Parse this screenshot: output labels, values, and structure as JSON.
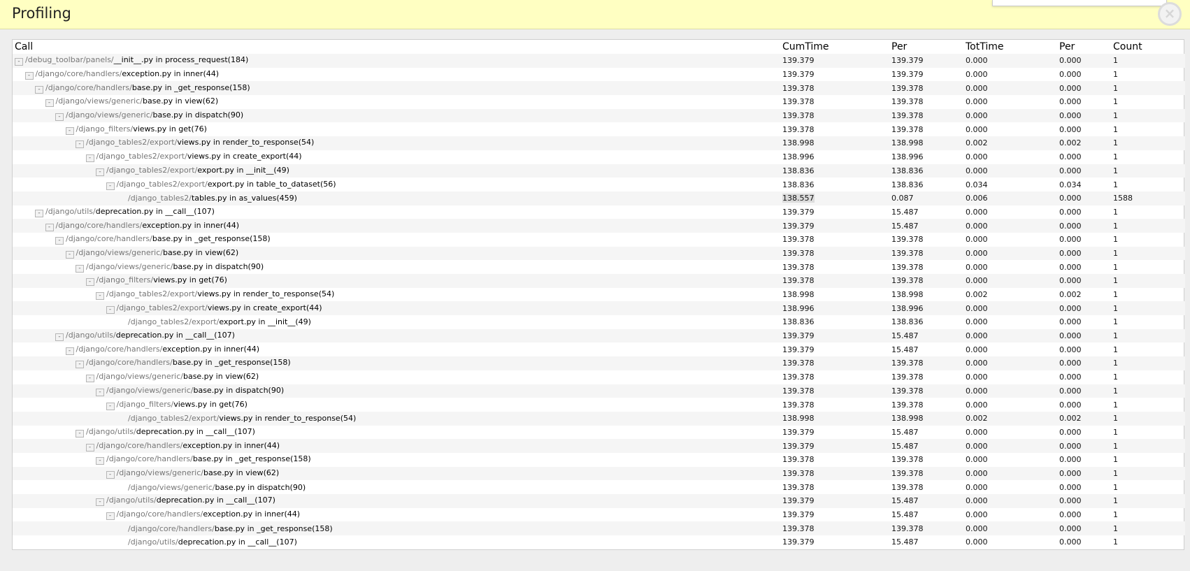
{
  "panel": {
    "title": "Profiling",
    "close_glyph": "×"
  },
  "table": {
    "headers": [
      "Call",
      "CumTime",
      "Per",
      "TotTime",
      "Per",
      "Count"
    ],
    "rows": [
      {
        "depth": 0,
        "toggle": true,
        "path": "/debug_toolbar/panels/",
        "file": "__init__.py",
        "mid": " in ",
        "func": "process_request",
        "line": "(184)",
        "cum": "139.379",
        "per": "139.379",
        "tot": "0.000",
        "per2": "0.000",
        "count": "1"
      },
      {
        "depth": 1,
        "toggle": true,
        "path": "/django/core/handlers/",
        "file": "exception.py",
        "mid": " in ",
        "func": "inner",
        "line": "(44)",
        "cum": "139.379",
        "per": "139.379",
        "tot": "0.000",
        "per2": "0.000",
        "count": "1"
      },
      {
        "depth": 2,
        "toggle": true,
        "path": "/django/core/handlers/",
        "file": "base.py",
        "mid": " in ",
        "func": "_get_response",
        "line": "(158)",
        "cum": "139.378",
        "per": "139.378",
        "tot": "0.000",
        "per2": "0.000",
        "count": "1"
      },
      {
        "depth": 3,
        "toggle": true,
        "path": "/django/views/generic/",
        "file": "base.py",
        "mid": " in ",
        "func": "view",
        "line": "(62)",
        "cum": "139.378",
        "per": "139.378",
        "tot": "0.000",
        "per2": "0.000",
        "count": "1"
      },
      {
        "depth": 4,
        "toggle": true,
        "path": "/django/views/generic/",
        "file": "base.py",
        "mid": " in ",
        "func": "dispatch",
        "line": "(90)",
        "cum": "139.378",
        "per": "139.378",
        "tot": "0.000",
        "per2": "0.000",
        "count": "1"
      },
      {
        "depth": 5,
        "toggle": true,
        "path": "/django_filters/",
        "file": "views.py",
        "mid": " in ",
        "func": "get",
        "line": "(76)",
        "cum": "139.378",
        "per": "139.378",
        "tot": "0.000",
        "per2": "0.000",
        "count": "1"
      },
      {
        "depth": 6,
        "toggle": true,
        "path": "/django_tables2/export/",
        "file": "views.py",
        "mid": " in ",
        "func": "render_to_response",
        "line": "(54)",
        "cum": "138.998",
        "per": "138.998",
        "tot": "0.002",
        "per2": "0.002",
        "count": "1"
      },
      {
        "depth": 7,
        "toggle": true,
        "path": "/django_tables2/export/",
        "file": "views.py",
        "mid": " in ",
        "func": "create_export",
        "line": "(44)",
        "cum": "138.996",
        "per": "138.996",
        "tot": "0.000",
        "per2": "0.000",
        "count": "1"
      },
      {
        "depth": 8,
        "toggle": true,
        "path": "/django_tables2/export/",
        "file": "export.py",
        "mid": " in ",
        "func": "__init__",
        "line": "(49)",
        "cum": "138.836",
        "per": "138.836",
        "tot": "0.000",
        "per2": "0.000",
        "count": "1"
      },
      {
        "depth": 9,
        "toggle": true,
        "path": "/django_tables2/export/",
        "file": "export.py",
        "mid": " in ",
        "func": "table_to_dataset",
        "line": "(56)",
        "cum": "138.836",
        "per": "138.836",
        "tot": "0.034",
        "per2": "0.034",
        "count": "1"
      },
      {
        "depth": 10,
        "toggle": false,
        "path": "/django_tables2/",
        "file": "tables.py",
        "mid": " in ",
        "func": "as_values",
        "line": "(459)",
        "cum": "138.557",
        "per": "0.087",
        "tot": "0.006",
        "per2": "0.000",
        "count": "1588",
        "highlight": true
      },
      {
        "depth": 2,
        "toggle": true,
        "path": "/django/utils/",
        "file": "deprecation.py",
        "mid": " in ",
        "func": "__call__",
        "line": "(107)",
        "cum": "139.379",
        "per": "15.487",
        "tot": "0.000",
        "per2": "0.000",
        "count": "1"
      },
      {
        "depth": 3,
        "toggle": true,
        "path": "/django/core/handlers/",
        "file": "exception.py",
        "mid": " in ",
        "func": "inner",
        "line": "(44)",
        "cum": "139.379",
        "per": "15.487",
        "tot": "0.000",
        "per2": "0.000",
        "count": "1"
      },
      {
        "depth": 4,
        "toggle": true,
        "path": "/django/core/handlers/",
        "file": "base.py",
        "mid": " in ",
        "func": "_get_response",
        "line": "(158)",
        "cum": "139.378",
        "per": "139.378",
        "tot": "0.000",
        "per2": "0.000",
        "count": "1"
      },
      {
        "depth": 5,
        "toggle": true,
        "path": "/django/views/generic/",
        "file": "base.py",
        "mid": " in ",
        "func": "view",
        "line": "(62)",
        "cum": "139.378",
        "per": "139.378",
        "tot": "0.000",
        "per2": "0.000",
        "count": "1"
      },
      {
        "depth": 6,
        "toggle": true,
        "path": "/django/views/generic/",
        "file": "base.py",
        "mid": " in ",
        "func": "dispatch",
        "line": "(90)",
        "cum": "139.378",
        "per": "139.378",
        "tot": "0.000",
        "per2": "0.000",
        "count": "1"
      },
      {
        "depth": 7,
        "toggle": true,
        "path": "/django_filters/",
        "file": "views.py",
        "mid": " in ",
        "func": "get",
        "line": "(76)",
        "cum": "139.378",
        "per": "139.378",
        "tot": "0.000",
        "per2": "0.000",
        "count": "1"
      },
      {
        "depth": 8,
        "toggle": true,
        "path": "/django_tables2/export/",
        "file": "views.py",
        "mid": " in ",
        "func": "render_to_response",
        "line": "(54)",
        "cum": "138.998",
        "per": "138.998",
        "tot": "0.002",
        "per2": "0.002",
        "count": "1"
      },
      {
        "depth": 9,
        "toggle": true,
        "path": "/django_tables2/export/",
        "file": "views.py",
        "mid": " in ",
        "func": "create_export",
        "line": "(44)",
        "cum": "138.996",
        "per": "138.996",
        "tot": "0.000",
        "per2": "0.000",
        "count": "1"
      },
      {
        "depth": 10,
        "toggle": false,
        "path": "/django_tables2/export/",
        "file": "export.py",
        "mid": " in ",
        "func": "__init__",
        "line": "(49)",
        "cum": "138.836",
        "per": "138.836",
        "tot": "0.000",
        "per2": "0.000",
        "count": "1"
      },
      {
        "depth": 4,
        "toggle": true,
        "path": "/django/utils/",
        "file": "deprecation.py",
        "mid": " in ",
        "func": "__call__",
        "line": "(107)",
        "cum": "139.379",
        "per": "15.487",
        "tot": "0.000",
        "per2": "0.000",
        "count": "1"
      },
      {
        "depth": 5,
        "toggle": true,
        "path": "/django/core/handlers/",
        "file": "exception.py",
        "mid": " in ",
        "func": "inner",
        "line": "(44)",
        "cum": "139.379",
        "per": "15.487",
        "tot": "0.000",
        "per2": "0.000",
        "count": "1"
      },
      {
        "depth": 6,
        "toggle": true,
        "path": "/django/core/handlers/",
        "file": "base.py",
        "mid": " in ",
        "func": "_get_response",
        "line": "(158)",
        "cum": "139.378",
        "per": "139.378",
        "tot": "0.000",
        "per2": "0.000",
        "count": "1"
      },
      {
        "depth": 7,
        "toggle": true,
        "path": "/django/views/generic/",
        "file": "base.py",
        "mid": " in ",
        "func": "view",
        "line": "(62)",
        "cum": "139.378",
        "per": "139.378",
        "tot": "0.000",
        "per2": "0.000",
        "count": "1"
      },
      {
        "depth": 8,
        "toggle": true,
        "path": "/django/views/generic/",
        "file": "base.py",
        "mid": " in ",
        "func": "dispatch",
        "line": "(90)",
        "cum": "139.378",
        "per": "139.378",
        "tot": "0.000",
        "per2": "0.000",
        "count": "1"
      },
      {
        "depth": 9,
        "toggle": true,
        "path": "/django_filters/",
        "file": "views.py",
        "mid": " in ",
        "func": "get",
        "line": "(76)",
        "cum": "139.378",
        "per": "139.378",
        "tot": "0.000",
        "per2": "0.000",
        "count": "1"
      },
      {
        "depth": 10,
        "toggle": false,
        "path": "/django_tables2/export/",
        "file": "views.py",
        "mid": " in ",
        "func": "render_to_response",
        "line": "(54)",
        "cum": "138.998",
        "per": "138.998",
        "tot": "0.002",
        "per2": "0.002",
        "count": "1"
      },
      {
        "depth": 6,
        "toggle": true,
        "path": "/django/utils/",
        "file": "deprecation.py",
        "mid": " in ",
        "func": "__call__",
        "line": "(107)",
        "cum": "139.379",
        "per": "15.487",
        "tot": "0.000",
        "per2": "0.000",
        "count": "1"
      },
      {
        "depth": 7,
        "toggle": true,
        "path": "/django/core/handlers/",
        "file": "exception.py",
        "mid": " in ",
        "func": "inner",
        "line": "(44)",
        "cum": "139.379",
        "per": "15.487",
        "tot": "0.000",
        "per2": "0.000",
        "count": "1"
      },
      {
        "depth": 8,
        "toggle": true,
        "path": "/django/core/handlers/",
        "file": "base.py",
        "mid": " in ",
        "func": "_get_response",
        "line": "(158)",
        "cum": "139.378",
        "per": "139.378",
        "tot": "0.000",
        "per2": "0.000",
        "count": "1"
      },
      {
        "depth": 9,
        "toggle": true,
        "path": "/django/views/generic/",
        "file": "base.py",
        "mid": " in ",
        "func": "view",
        "line": "(62)",
        "cum": "139.378",
        "per": "139.378",
        "tot": "0.000",
        "per2": "0.000",
        "count": "1"
      },
      {
        "depth": 10,
        "toggle": false,
        "path": "/django/views/generic/",
        "file": "base.py",
        "mid": " in ",
        "func": "dispatch",
        "line": "(90)",
        "cum": "139.378",
        "per": "139.378",
        "tot": "0.000",
        "per2": "0.000",
        "count": "1"
      },
      {
        "depth": 8,
        "toggle": true,
        "path": "/django/utils/",
        "file": "deprecation.py",
        "mid": " in ",
        "func": "__call__",
        "line": "(107)",
        "cum": "139.379",
        "per": "15.487",
        "tot": "0.000",
        "per2": "0.000",
        "count": "1"
      },
      {
        "depth": 9,
        "toggle": true,
        "path": "/django/core/handlers/",
        "file": "exception.py",
        "mid": " in ",
        "func": "inner",
        "line": "(44)",
        "cum": "139.379",
        "per": "15.487",
        "tot": "0.000",
        "per2": "0.000",
        "count": "1"
      },
      {
        "depth": 10,
        "toggle": false,
        "path": "/django/core/handlers/",
        "file": "base.py",
        "mid": " in ",
        "func": "_get_response",
        "line": "(158)",
        "cum": "139.378",
        "per": "139.378",
        "tot": "0.000",
        "per2": "0.000",
        "count": "1"
      },
      {
        "depth": 10,
        "toggle": false,
        "path": "/django/utils/",
        "file": "deprecation.py",
        "mid": " in ",
        "func": "__call__",
        "line": "(107)",
        "cum": "139.379",
        "per": "15.487",
        "tot": "0.000",
        "per2": "0.000",
        "count": "1"
      }
    ]
  },
  "icons": {
    "toggle_glyph": "-"
  }
}
